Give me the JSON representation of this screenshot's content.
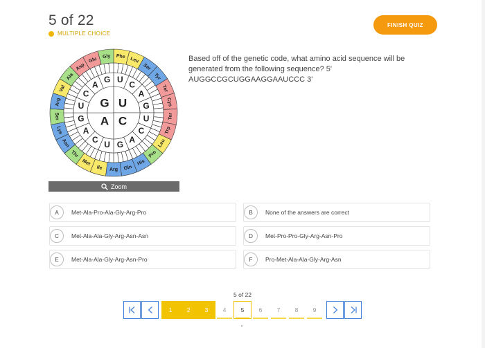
{
  "header": {
    "count": "5 of 22",
    "type": "MULTIPLE CHOICE",
    "finish_label": "FINISH QUIZ"
  },
  "question": {
    "text": "Based off of the genetic code, what amino acid sequence will be generated from the following sequence? 5' AUGGCCGCUGGAAGGAAUCCC 3'"
  },
  "image": {
    "zoom_label": "Zoom"
  },
  "codon_wheel": {
    "center": [
      "G",
      "U",
      "A",
      "C"
    ],
    "second_ring": [
      "U",
      "C",
      "A",
      "G",
      "U",
      "C",
      "A",
      "G",
      "U",
      "C",
      "A",
      "G",
      "U",
      "C",
      "A",
      "G"
    ],
    "amino_acids": [
      "Phe",
      "Leu",
      "Ser",
      "Tyr",
      "Ter",
      "Cys",
      "Ter",
      "Trp",
      "Leu",
      "Pro",
      "His",
      "Gln",
      "Arg",
      "Ile",
      "Met",
      "Thr",
      "Asn",
      "Lys",
      "Ser",
      "Arg",
      "Val",
      "Ala",
      "Asp",
      "Glu",
      "Gly"
    ]
  },
  "answers": [
    {
      "letter": "A",
      "text": "Met-Ala-Pro-Ala-Gly-Arg-Pro"
    },
    {
      "letter": "B",
      "text": "None of the answers are correct"
    },
    {
      "letter": "C",
      "text": "Met-Ala-Ala-Gly-Arg-Asn-Asn"
    },
    {
      "letter": "D",
      "text": "Met-Pro-Pro-Gly-Arg-Asn-Pro"
    },
    {
      "letter": "E",
      "text": "Met-Ala-Ala-Gly-Arg-Asn-Pro"
    },
    {
      "letter": "F",
      "text": "Pro-Met-Ala-Ala-Gly-Arg-Asn"
    }
  ],
  "pagination": {
    "label": "5 of 22",
    "pages": [
      "1",
      "2",
      "3",
      "4",
      "5",
      "6",
      "7",
      "8",
      "9"
    ],
    "completed": 3,
    "current": 5
  },
  "colors": {
    "accent": "#f59a0f",
    "progress": "#f2c300",
    "nav": "#3f7fd6"
  }
}
